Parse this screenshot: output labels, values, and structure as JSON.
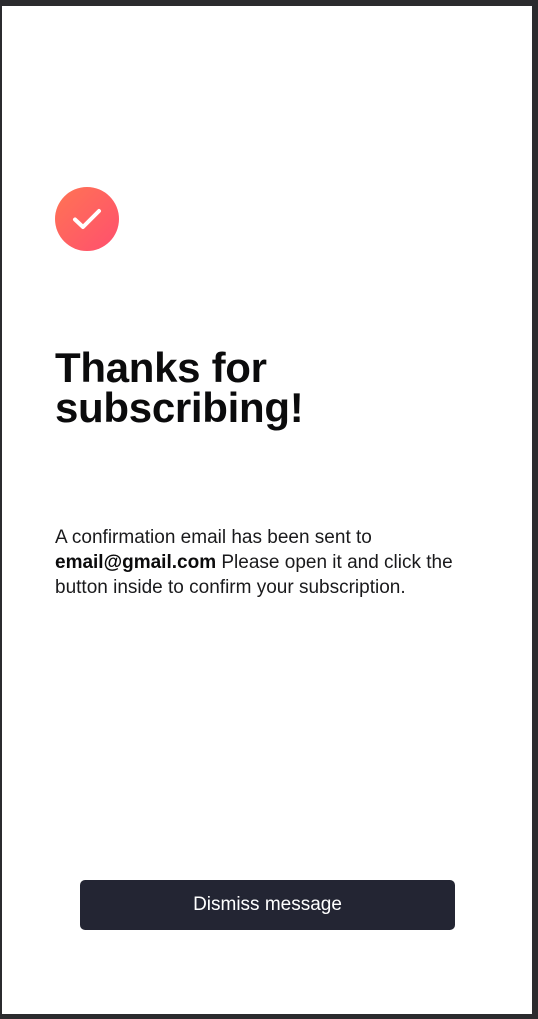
{
  "header": {
    "icon": "checkmark-icon",
    "title_line1": "Thanks for",
    "title_line2": "subscribing!"
  },
  "message": {
    "intro": "A confirmation email has been sent to",
    "email": "email@gmail.com",
    "outro": "Please open it and click the button inside to confirm your subscription."
  },
  "actions": {
    "dismiss_label": "Dismiss message"
  },
  "colors": {
    "accent_start": "#ff7454",
    "accent_end": "#ff4f6e",
    "button_bg": "#232533",
    "button_text": "#ffffff",
    "page_bg": "#ffffff"
  }
}
